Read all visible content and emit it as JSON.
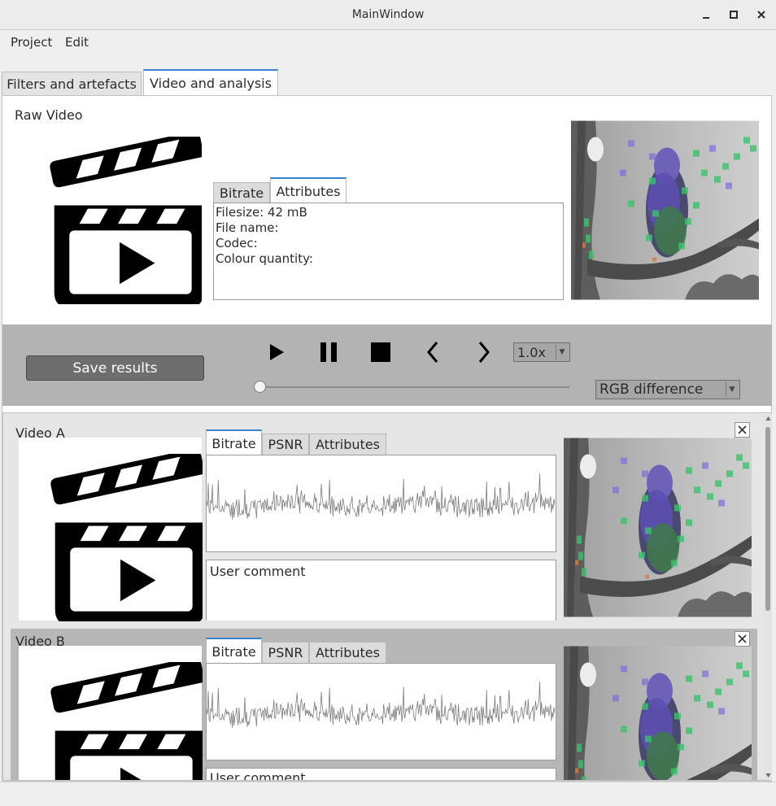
{
  "window": {
    "title": "MainWindow"
  },
  "menu": [
    {
      "label": "Project"
    },
    {
      "label": "Edit"
    }
  ],
  "main_tabs": [
    {
      "label": "Filters and artefacts",
      "active": false
    },
    {
      "label": "Video and analysis",
      "active": true
    }
  ],
  "raw_video": {
    "label": "Raw Video",
    "tabs": [
      {
        "label": "Bitrate",
        "active": false
      },
      {
        "label": "Attributes",
        "active": true
      }
    ],
    "attributes": [
      "Filesize: 42 mB",
      "File name:",
      "Codec:",
      "Colour quantity:"
    ]
  },
  "controls": {
    "save_label": "Save results",
    "speed": "1.0x",
    "comparison_mode": "RGB difference",
    "seek_position": 0
  },
  "videos": [
    {
      "label": "Video A",
      "tabs": [
        {
          "label": "Bitrate",
          "active": true
        },
        {
          "label": "PSNR",
          "active": false
        },
        {
          "label": "Attributes",
          "active": false
        }
      ],
      "comment": "User comment"
    },
    {
      "label": "Video B",
      "tabs": [
        {
          "label": "Bitrate",
          "active": true
        },
        {
          "label": "PSNR",
          "active": false
        },
        {
          "label": "Attributes",
          "active": false
        }
      ],
      "comment": "User comment"
    }
  ],
  "icons": {
    "minimize": "minimize-icon",
    "maximize": "maximize-icon",
    "close": "close-icon",
    "play": "play-icon",
    "pause": "pause-icon",
    "stop": "stop-icon",
    "prev": "previous-frame-icon",
    "next": "next-frame-icon",
    "clapper": "video-clapperboard-icon"
  },
  "colors": {
    "accent": "#3b82d1",
    "control_bar": "#b3b3b3",
    "save_button": "#6e6e6e",
    "plot_line": "#7d7d7d"
  }
}
